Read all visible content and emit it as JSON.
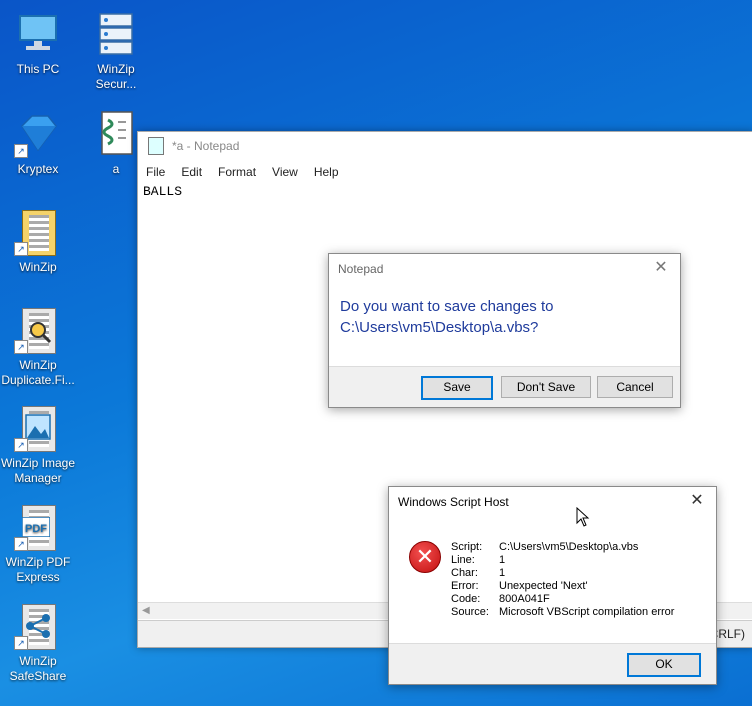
{
  "desktop": {
    "icons": [
      {
        "label": "This PC"
      },
      {
        "label": "WinZip Secur..."
      },
      {
        "label": "Kryptex"
      },
      {
        "label": "a"
      },
      {
        "label": "WinZip"
      },
      {
        "label": "WinZip Duplicate.Fi..."
      },
      {
        "label": "WinZip Image Manager"
      },
      {
        "label": "WinZip PDF Express"
      },
      {
        "label": "WinZip SafeShare"
      }
    ],
    "shortcut_arrow": "↗"
  },
  "notepad": {
    "title": "*a - Notepad",
    "menu": [
      "File",
      "Edit",
      "Format",
      "View",
      "Help"
    ],
    "content": "BALLS",
    "status_fragment": "CRLF)"
  },
  "save_dialog": {
    "title": "Notepad",
    "message_line1": "Do you want to save changes to",
    "message_line2": "C:\\Users\\vm5\\Desktop\\a.vbs?",
    "buttons": {
      "save": "Save",
      "dont_save": "Don't Save",
      "cancel": "Cancel"
    },
    "close_glyph": "✕"
  },
  "wsh_dialog": {
    "title": "Windows Script Host",
    "close_glyph": "✕",
    "icon_glyph": "✕",
    "rows": [
      {
        "key": "Script:",
        "value": "C:\\Users\\vm5\\Desktop\\a.vbs"
      },
      {
        "key": "Line:",
        "value": "1"
      },
      {
        "key": "Char:",
        "value": "1"
      },
      {
        "key": "Error:",
        "value": "Unexpected 'Next'"
      },
      {
        "key": "Code:",
        "value": "800A041F"
      },
      {
        "key": "Source:",
        "value": "Microsoft VBScript compilation error"
      }
    ],
    "ok_label": "OK"
  },
  "colors": {
    "desktop_bg": "#0b78d8",
    "dialog_accent": "#0078d7",
    "message_text": "#1f3b9c",
    "error_red": "#c21010"
  }
}
